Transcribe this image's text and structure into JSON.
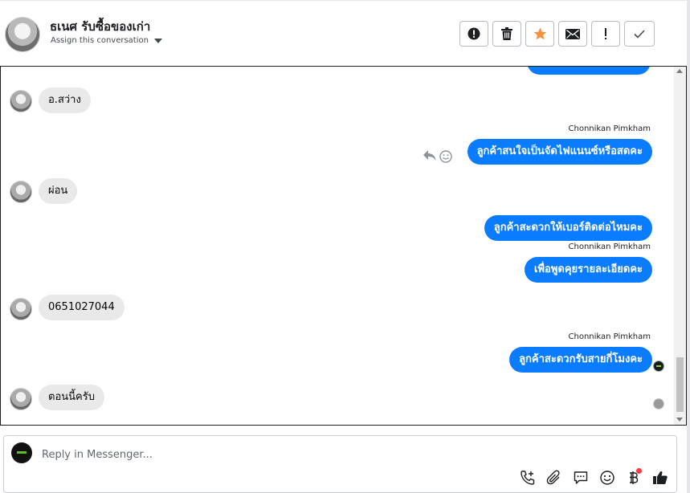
{
  "header": {
    "contact_name": "ธเนศ รับซื้อของเก่า",
    "assign_label": "Assign this conversation",
    "actions": [
      {
        "name": "mark-spam",
        "icon": "alert-circle-icon"
      },
      {
        "name": "delete",
        "icon": "trash-icon"
      },
      {
        "name": "star",
        "icon": "star-icon"
      },
      {
        "name": "mark-unread",
        "icon": "envelope-icon"
      },
      {
        "name": "follow-up",
        "icon": "exclamation-icon"
      },
      {
        "name": "mark-done",
        "icon": "checkmark-icon"
      }
    ]
  },
  "messages": {
    "m1": {
      "direction": "incoming",
      "text": "อ.สว่าง"
    },
    "m2": {
      "direction": "outgoing",
      "sender": "Chonnikan Pimkham",
      "text": "ลูกค้าสนใจเป็นจัดไฟแนนซ์หรือสดคะ"
    },
    "m3": {
      "direction": "incoming",
      "text": "ผ่อน"
    },
    "m4": {
      "direction": "outgoing",
      "text": "ลูกค้าสะดวกให้เบอร์ติดต่อไหมคะ"
    },
    "m5": {
      "direction": "outgoing",
      "sender": "Chonnikan Pimkham",
      "text": "เพื่อพูดคุยรายละเอียดคะ"
    },
    "m6": {
      "direction": "incoming",
      "text": "0651027044"
    },
    "m7": {
      "direction": "outgoing",
      "sender": "Chonnikan Pimkham",
      "text": "ลูกค้าสะดวกรับสายกี่โมงคะ"
    },
    "m8": {
      "direction": "incoming",
      "text": "ตอนนี้ครับ"
    }
  },
  "composer": {
    "placeholder": "Reply in Messenger...",
    "value": "",
    "tools": [
      "phone-plus-icon",
      "paperclip-icon",
      "chat-bubble-icon",
      "emoji-icon",
      "baht-icon",
      "thumbs-up-icon"
    ]
  },
  "colors": {
    "outgoing_bubble": "#0a7cff",
    "incoming_bubble": "#e9e9ea",
    "star": "#f5923e"
  }
}
